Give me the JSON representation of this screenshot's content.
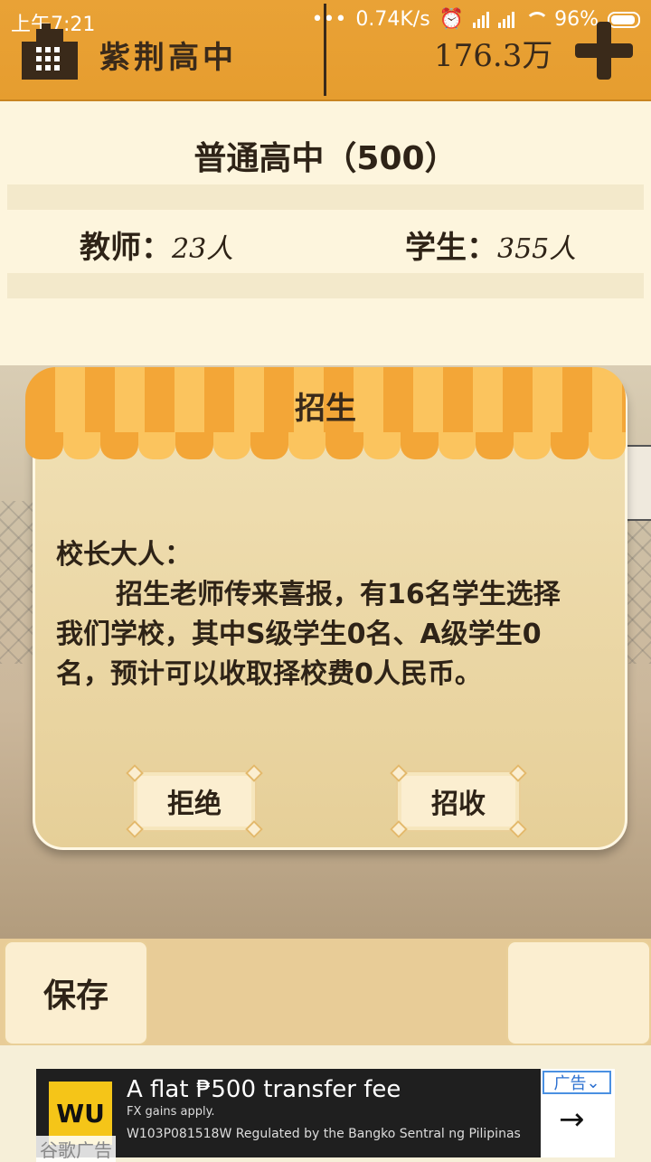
{
  "status_bar": {
    "time": "上午7:21",
    "net_speed": "0.74K/s",
    "battery": "96%"
  },
  "header": {
    "school_name": "紫荆高中",
    "money": "176.3万",
    "add_icon": "plus-icon",
    "school_icon": "building-icon"
  },
  "info": {
    "school_type": "普通高中（500）",
    "teacher_label": "教师：",
    "teacher_count": "23人",
    "student_label": "学生：",
    "student_count": "355人"
  },
  "dialog": {
    "title": "招生",
    "greeting": "校长大人：",
    "message": "招生老师传来喜报，有16名学生选择我们学校，其中S级学生0名、A级学生0名，预计可以收取择校费0人民币。",
    "reject_label": "拒绝",
    "accept_label": "招收"
  },
  "bottom": {
    "save_label": "保存"
  },
  "ad": {
    "logo": "WU",
    "headline": "A flat ₱500 transfer fee",
    "sub": "FX gains apply.",
    "regulation": "W103P081518W Regulated by the Bangko Sentral ng Pilipinas",
    "tag": "广告",
    "label": "谷歌广告"
  },
  "colors": {
    "header": "#e69d2f",
    "panel": "#fdf5dd",
    "dialog": "#efdcae"
  }
}
